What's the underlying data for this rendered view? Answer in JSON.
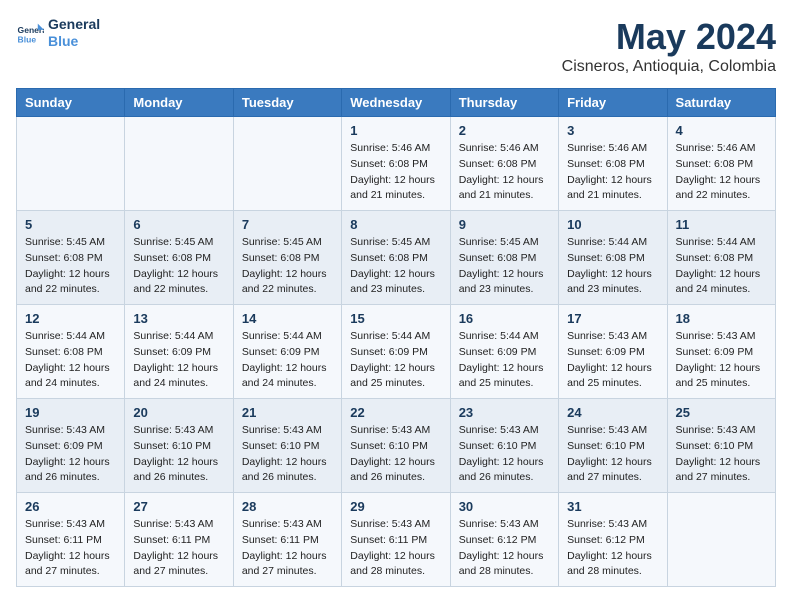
{
  "logo": {
    "line1": "General",
    "line2": "Blue"
  },
  "title": "May 2024",
  "subtitle": "Cisneros, Antioquia, Colombia",
  "days_header": [
    "Sunday",
    "Monday",
    "Tuesday",
    "Wednesday",
    "Thursday",
    "Friday",
    "Saturday"
  ],
  "weeks": [
    {
      "cells": [
        {
          "day": "",
          "info": ""
        },
        {
          "day": "",
          "info": ""
        },
        {
          "day": "",
          "info": ""
        },
        {
          "day": "1",
          "info": "Sunrise: 5:46 AM\nSunset: 6:08 PM\nDaylight: 12 hours\nand 21 minutes."
        },
        {
          "day": "2",
          "info": "Sunrise: 5:46 AM\nSunset: 6:08 PM\nDaylight: 12 hours\nand 21 minutes."
        },
        {
          "day": "3",
          "info": "Sunrise: 5:46 AM\nSunset: 6:08 PM\nDaylight: 12 hours\nand 21 minutes."
        },
        {
          "day": "4",
          "info": "Sunrise: 5:46 AM\nSunset: 6:08 PM\nDaylight: 12 hours\nand 22 minutes."
        }
      ]
    },
    {
      "cells": [
        {
          "day": "5",
          "info": "Sunrise: 5:45 AM\nSunset: 6:08 PM\nDaylight: 12 hours\nand 22 minutes."
        },
        {
          "day": "6",
          "info": "Sunrise: 5:45 AM\nSunset: 6:08 PM\nDaylight: 12 hours\nand 22 minutes."
        },
        {
          "day": "7",
          "info": "Sunrise: 5:45 AM\nSunset: 6:08 PM\nDaylight: 12 hours\nand 22 minutes."
        },
        {
          "day": "8",
          "info": "Sunrise: 5:45 AM\nSunset: 6:08 PM\nDaylight: 12 hours\nand 23 minutes."
        },
        {
          "day": "9",
          "info": "Sunrise: 5:45 AM\nSunset: 6:08 PM\nDaylight: 12 hours\nand 23 minutes."
        },
        {
          "day": "10",
          "info": "Sunrise: 5:44 AM\nSunset: 6:08 PM\nDaylight: 12 hours\nand 23 minutes."
        },
        {
          "day": "11",
          "info": "Sunrise: 5:44 AM\nSunset: 6:08 PM\nDaylight: 12 hours\nand 24 minutes."
        }
      ]
    },
    {
      "cells": [
        {
          "day": "12",
          "info": "Sunrise: 5:44 AM\nSunset: 6:08 PM\nDaylight: 12 hours\nand 24 minutes."
        },
        {
          "day": "13",
          "info": "Sunrise: 5:44 AM\nSunset: 6:09 PM\nDaylight: 12 hours\nand 24 minutes."
        },
        {
          "day": "14",
          "info": "Sunrise: 5:44 AM\nSunset: 6:09 PM\nDaylight: 12 hours\nand 24 minutes."
        },
        {
          "day": "15",
          "info": "Sunrise: 5:44 AM\nSunset: 6:09 PM\nDaylight: 12 hours\nand 25 minutes."
        },
        {
          "day": "16",
          "info": "Sunrise: 5:44 AM\nSunset: 6:09 PM\nDaylight: 12 hours\nand 25 minutes."
        },
        {
          "day": "17",
          "info": "Sunrise: 5:43 AM\nSunset: 6:09 PM\nDaylight: 12 hours\nand 25 minutes."
        },
        {
          "day": "18",
          "info": "Sunrise: 5:43 AM\nSunset: 6:09 PM\nDaylight: 12 hours\nand 25 minutes."
        }
      ]
    },
    {
      "cells": [
        {
          "day": "19",
          "info": "Sunrise: 5:43 AM\nSunset: 6:09 PM\nDaylight: 12 hours\nand 26 minutes."
        },
        {
          "day": "20",
          "info": "Sunrise: 5:43 AM\nSunset: 6:10 PM\nDaylight: 12 hours\nand 26 minutes."
        },
        {
          "day": "21",
          "info": "Sunrise: 5:43 AM\nSunset: 6:10 PM\nDaylight: 12 hours\nand 26 minutes."
        },
        {
          "day": "22",
          "info": "Sunrise: 5:43 AM\nSunset: 6:10 PM\nDaylight: 12 hours\nand 26 minutes."
        },
        {
          "day": "23",
          "info": "Sunrise: 5:43 AM\nSunset: 6:10 PM\nDaylight: 12 hours\nand 26 minutes."
        },
        {
          "day": "24",
          "info": "Sunrise: 5:43 AM\nSunset: 6:10 PM\nDaylight: 12 hours\nand 27 minutes."
        },
        {
          "day": "25",
          "info": "Sunrise: 5:43 AM\nSunset: 6:10 PM\nDaylight: 12 hours\nand 27 minutes."
        }
      ]
    },
    {
      "cells": [
        {
          "day": "26",
          "info": "Sunrise: 5:43 AM\nSunset: 6:11 PM\nDaylight: 12 hours\nand 27 minutes."
        },
        {
          "day": "27",
          "info": "Sunrise: 5:43 AM\nSunset: 6:11 PM\nDaylight: 12 hours\nand 27 minutes."
        },
        {
          "day": "28",
          "info": "Sunrise: 5:43 AM\nSunset: 6:11 PM\nDaylight: 12 hours\nand 27 minutes."
        },
        {
          "day": "29",
          "info": "Sunrise: 5:43 AM\nSunset: 6:11 PM\nDaylight: 12 hours\nand 28 minutes."
        },
        {
          "day": "30",
          "info": "Sunrise: 5:43 AM\nSunset: 6:12 PM\nDaylight: 12 hours\nand 28 minutes."
        },
        {
          "day": "31",
          "info": "Sunrise: 5:43 AM\nSunset: 6:12 PM\nDaylight: 12 hours\nand 28 minutes."
        },
        {
          "day": "",
          "info": ""
        }
      ]
    }
  ]
}
